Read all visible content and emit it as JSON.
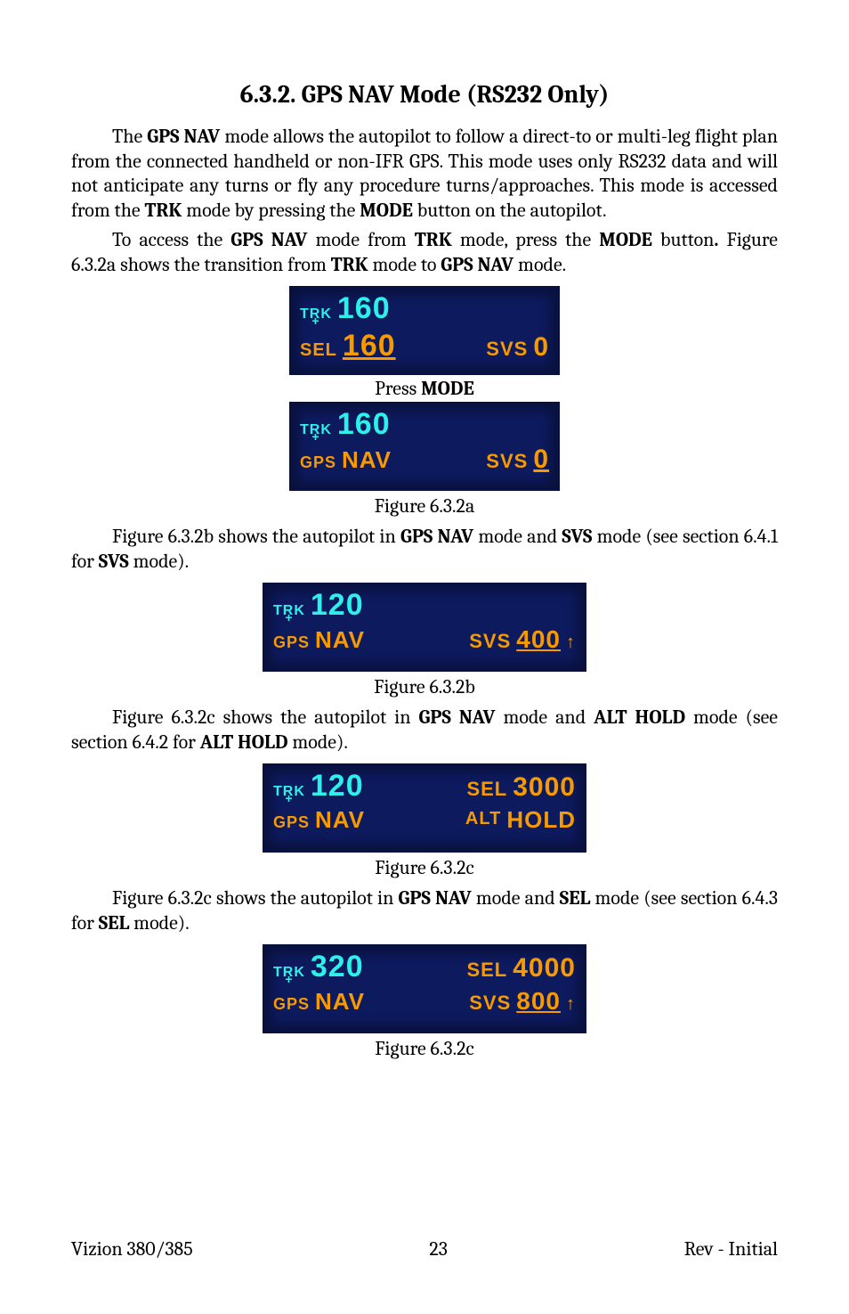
{
  "heading": "6.3.2.   GPS NAV Mode (RS232 Only)",
  "para1_a": "The ",
  "para1_b": "GPS NAV",
  "para1_c": " mode allows the autopilot to follow a direct-to or multi-leg flight plan from the connected handheld or non-IFR GPS. This mode uses only RS232 data and will not anticipate any turns or fly any procedure turns/approaches.  This mode is accessed from the ",
  "para1_d": "TRK",
  "para1_e": " mode by pressing the ",
  "para1_f": "MODE",
  "para1_g": " button on the autopilot.",
  "para2_a": "To access the ",
  "para2_b": "GPS NAV",
  "para2_c": " mode from ",
  "para2_d": "TRK",
  "para2_e": " mode, press the ",
  "para2_f": "MODE",
  "para2_g": " button",
  "para2_h": ".",
  "para2_i": "  Figure 6.3.2a shows the transition from ",
  "para2_j": "TRK",
  "para2_k": " mode to ",
  "para2_l": "GPS NAV",
  "para2_m": " mode.",
  "pressMode_a": "Press ",
  "pressMode_b": "MODE",
  "caption_a": "Figure 6.3.2a",
  "para3_a": "Figure 6.3.2b shows the autopilot in ",
  "para3_b": "GPS NAV",
  "para3_c": " mode and ",
  "para3_d": "SVS",
  "para3_e": " mode (see section 6.4.1 for ",
  "para3_f": "SVS",
  "para3_g": " mode).",
  "caption_b": "Figure 6.3.2b",
  "para4_a": "Figure 6.3.2c shows the autopilot in ",
  "para4_b": "GPS NAV",
  "para4_c": " mode and ",
  "para4_d": "ALT HOLD",
  "para4_e": " mode (see section 6.4.2 for ",
  "para4_f": "ALT HOLD",
  "para4_g": " mode).",
  "caption_c": "Figure 6.3.2c",
  "para5_a": "Figure 6.3.2c shows the autopilot in ",
  "para5_b": "GPS NAV",
  "para5_c": " mode and ",
  "para5_d": "SEL",
  "para5_e": " mode (see section 6.4.3 for ",
  "para5_f": "SEL",
  "para5_g": " mode).",
  "caption_d": "Figure 6.3.2c",
  "footer": {
    "left": "Vizion 380/385",
    "center": "23",
    "right": "Rev - Initial"
  },
  "lcd": {
    "trk": "TRK",
    "plus": "+",
    "sel": "SEL",
    "gps": "GPS",
    "nav": "NAV",
    "svs": "SVS",
    "alt": "ALT",
    "hold": "HOLD",
    "v160": "160",
    "v160u": "160",
    "v0": "0",
    "v120": "120",
    "v400": "400",
    "v3000": "3000",
    "v320": "320",
    "v4000": "4000",
    "v800": "800",
    "arrowUp": "↑"
  }
}
